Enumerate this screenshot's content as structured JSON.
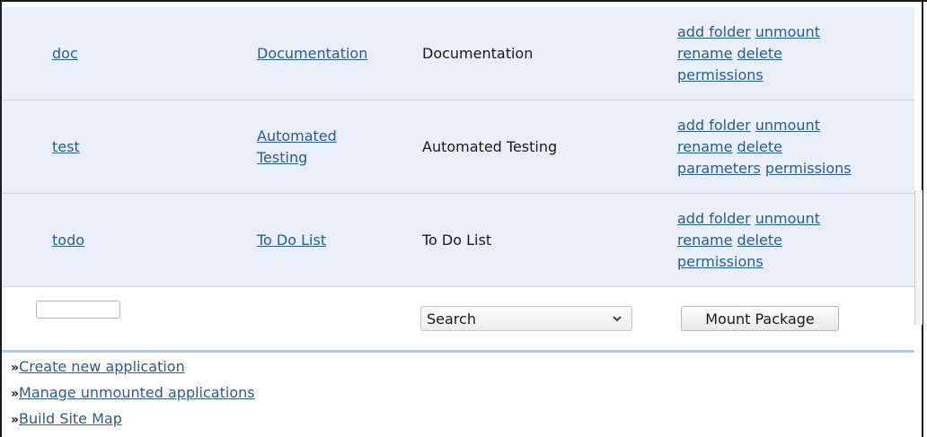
{
  "apps": [
    {
      "name": "doc",
      "title": "Documentation",
      "description": "Documentation",
      "actions": [
        "add folder",
        "unmount",
        "rename",
        "delete",
        "permissions"
      ]
    },
    {
      "name": "test",
      "title": "Automated Testing",
      "description": "Automated Testing",
      "actions": [
        "add folder",
        "unmount",
        "rename",
        "delete",
        "parameters",
        "permissions"
      ]
    },
    {
      "name": "todo",
      "title": "To Do List",
      "description": "To Do List",
      "actions": [
        "add folder",
        "unmount",
        "rename",
        "delete",
        "permissions"
      ]
    }
  ],
  "mount_form": {
    "name_value": "",
    "package_select": "Search",
    "mount_button": "Mount Package"
  },
  "footer_links": {
    "bullet": "»",
    "create": "Create new application",
    "manage": "Manage unmounted applications",
    "sitemap": "Build Site Map"
  }
}
